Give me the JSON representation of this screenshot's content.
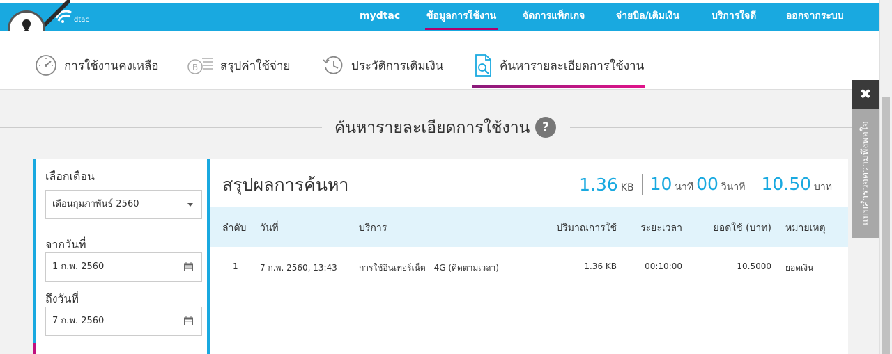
{
  "brand": {
    "name": "dtac"
  },
  "topnav": [
    {
      "label": "mydtac",
      "active": false
    },
    {
      "label": "ข้อมูลการใช้งาน",
      "active": true
    },
    {
      "label": "จัดการแพ็กเกจ",
      "active": false
    },
    {
      "label": "จ่ายบิล/เติมเงิน",
      "active": false
    },
    {
      "label": "บริการใจดี",
      "active": false
    },
    {
      "label": "ออกจากระบบ",
      "active": false
    }
  ],
  "subnav": [
    {
      "label": "การใช้งานคงเหลือ",
      "icon": "speedometer-icon"
    },
    {
      "label": "สรุปค่าใช้จ่าย",
      "icon": "bill-icon"
    },
    {
      "label": "ประวัติการเติมเงิน",
      "icon": "history-icon"
    },
    {
      "label": "ค้นหารายละเอียดการใช้งาน",
      "icon": "document-search-icon",
      "active": true
    }
  ],
  "page": {
    "title": "ค้นหารายละเอียดการใช้งาน",
    "help": "?"
  },
  "filter": {
    "month_label": "เลือกเดือน",
    "month_value": "เดือนกุมภาพันธ์ 2560",
    "from_label": "จากวันที่",
    "from_value": "1 ก.พ. 2560",
    "to_label": "ถึงวันที่",
    "to_value": "7 ก.พ. 2560"
  },
  "results": {
    "title": "สรุปผลการค้นหา",
    "stats": {
      "data_value": "1.36",
      "data_unit": "KB",
      "minutes_value": "10",
      "minutes_unit": "นาที",
      "seconds_value": "00",
      "seconds_unit": "วินาที",
      "cost_value": "10.50",
      "cost_unit": "บาท"
    },
    "columns": [
      "ลำดับ",
      "วันที่",
      "บริการ",
      "ปริมาณการใช้",
      "ระยะเวลา",
      "ยอดใช้ (บาท)",
      "หมายเหตุ"
    ],
    "rows": [
      [
        "1",
        "7 ก.พ. 2560, 13:43",
        "การใช้อินเทอร์เน็ต - 4G (คิดตามเวลา)",
        "1.36 KB",
        "00:10:00",
        "10.5000",
        "ยอดเงิน"
      ]
    ]
  },
  "feedback": {
    "close": "✖",
    "label": "แบบสำรวจความพึงพอใจ"
  },
  "colors": {
    "primary": "#19a9e0",
    "accent": "#b0006e",
    "panel_header": "#e1f3fb"
  }
}
